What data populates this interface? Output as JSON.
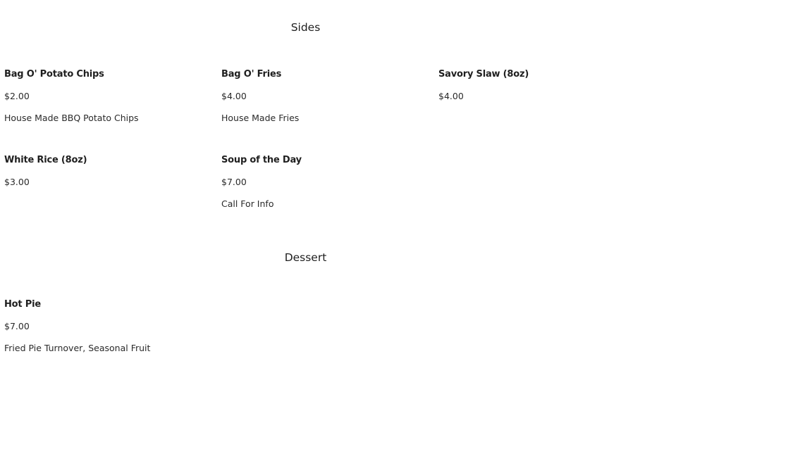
{
  "sections": [
    {
      "title": "Sides",
      "items": [
        {
          "name": "Bag O' Potato Chips",
          "price": "$2.00",
          "description": "House Made BBQ Potato Chips"
        },
        {
          "name": "Bag O' Fries",
          "price": "$4.00",
          "description": "House Made Fries"
        },
        {
          "name": "Savory Slaw (8oz)",
          "price": "$4.00",
          "description": ""
        },
        {
          "name": "White Rice (8oz)",
          "price": "$3.00",
          "description": ""
        },
        {
          "name": "Soup of the Day",
          "price": "$7.00",
          "description": "Call For Info"
        }
      ]
    },
    {
      "title": "Dessert",
      "items": [
        {
          "name": "Hot Pie",
          "price": "$7.00",
          "description": "Fried Pie Turnover, Seasonal Fruit"
        }
      ]
    }
  ]
}
